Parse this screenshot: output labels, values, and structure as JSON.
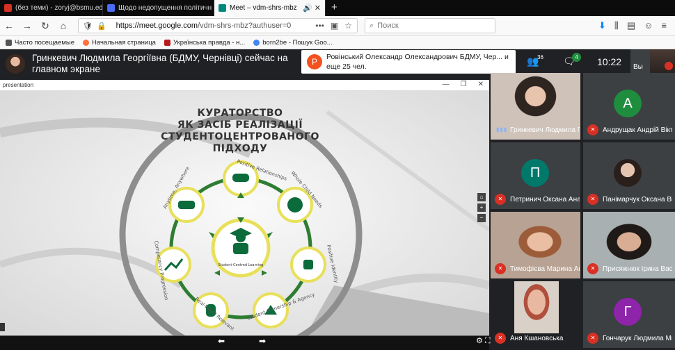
{
  "browser": {
    "tabs": [
      {
        "label": "(без теми) - zoryj@bsmu.edu.",
        "color": "#d93025"
      },
      {
        "label": "Щодо недопущення політичн",
        "color": "#4a6cf7"
      },
      {
        "label": "Meet – vdm-shrs-mbz",
        "color": "#00897b",
        "active": true
      }
    ],
    "new_tab": "+",
    "url_host": "https://meet.google.com",
    "url_path": "/vdm-shrs-mbz?authuser=0",
    "search_placeholder": "Поиск",
    "bookmarks": [
      "Часто посещаемые",
      "Начальная страница",
      "Українська правда - н...",
      "born2be - Пошук Goo..."
    ]
  },
  "meet": {
    "presenter_text": "Гринкевич Людмила Георгіївна (БДМУ, Чернівці) сейчас на главном экране",
    "notification_initial": "Р",
    "notification_text": "Ровінський Олександр Олександрович БДМУ, Чер... и еще 25 чел.",
    "people_count": "36",
    "chat_badge": "4",
    "clock": "10:22",
    "self_label": "Вы"
  },
  "presentation": {
    "window_label": "presentation",
    "title_lines": [
      "КУРАТОРСТВО",
      "ЯК ЗАСІБ РЕАЛІЗАЦІЇ",
      "СТУДЕНТОЦЕНТРОВАНОГО",
      "ПІДХОДУ"
    ],
    "center_label": "Student-Centred Learning",
    "ring_labels": [
      "Positive Relationships",
      "Whole Child Needs",
      "Positive Identity",
      "Student Ownership & Agency",
      "Real-World Relevant",
      "Competency Progression",
      "Anytime, Anywhere"
    ],
    "zoom": [
      "⌂",
      "+",
      "−"
    ]
  },
  "participants": [
    {
      "name": "Гринкевич Людмила Георгіївна",
      "muted": false,
      "type": "video"
    },
    {
      "name": "Андрущак Андрій Вікторович",
      "muted": true,
      "type": "initial",
      "initial": "А",
      "color": "#1e8e3e"
    },
    {
      "name": "Петринич Оксана Анатоліївна",
      "muted": true,
      "type": "initial",
      "initial": "П",
      "color": "#00796b"
    },
    {
      "name": "Панімарчук Оксана Віталіївна",
      "muted": true,
      "type": "photo"
    },
    {
      "name": "Тимофієва Марина Анатоліївна",
      "muted": true,
      "type": "video"
    },
    {
      "name": "Присяжнюк Ірина Василівна",
      "muted": true,
      "type": "video"
    },
    {
      "name": "Аня Кшановська",
      "muted": true,
      "type": "video"
    },
    {
      "name": "Гончарук Людмила Михайлівна",
      "muted": true,
      "type": "initial",
      "initial": "Г",
      "color": "#8e24aa"
    }
  ]
}
